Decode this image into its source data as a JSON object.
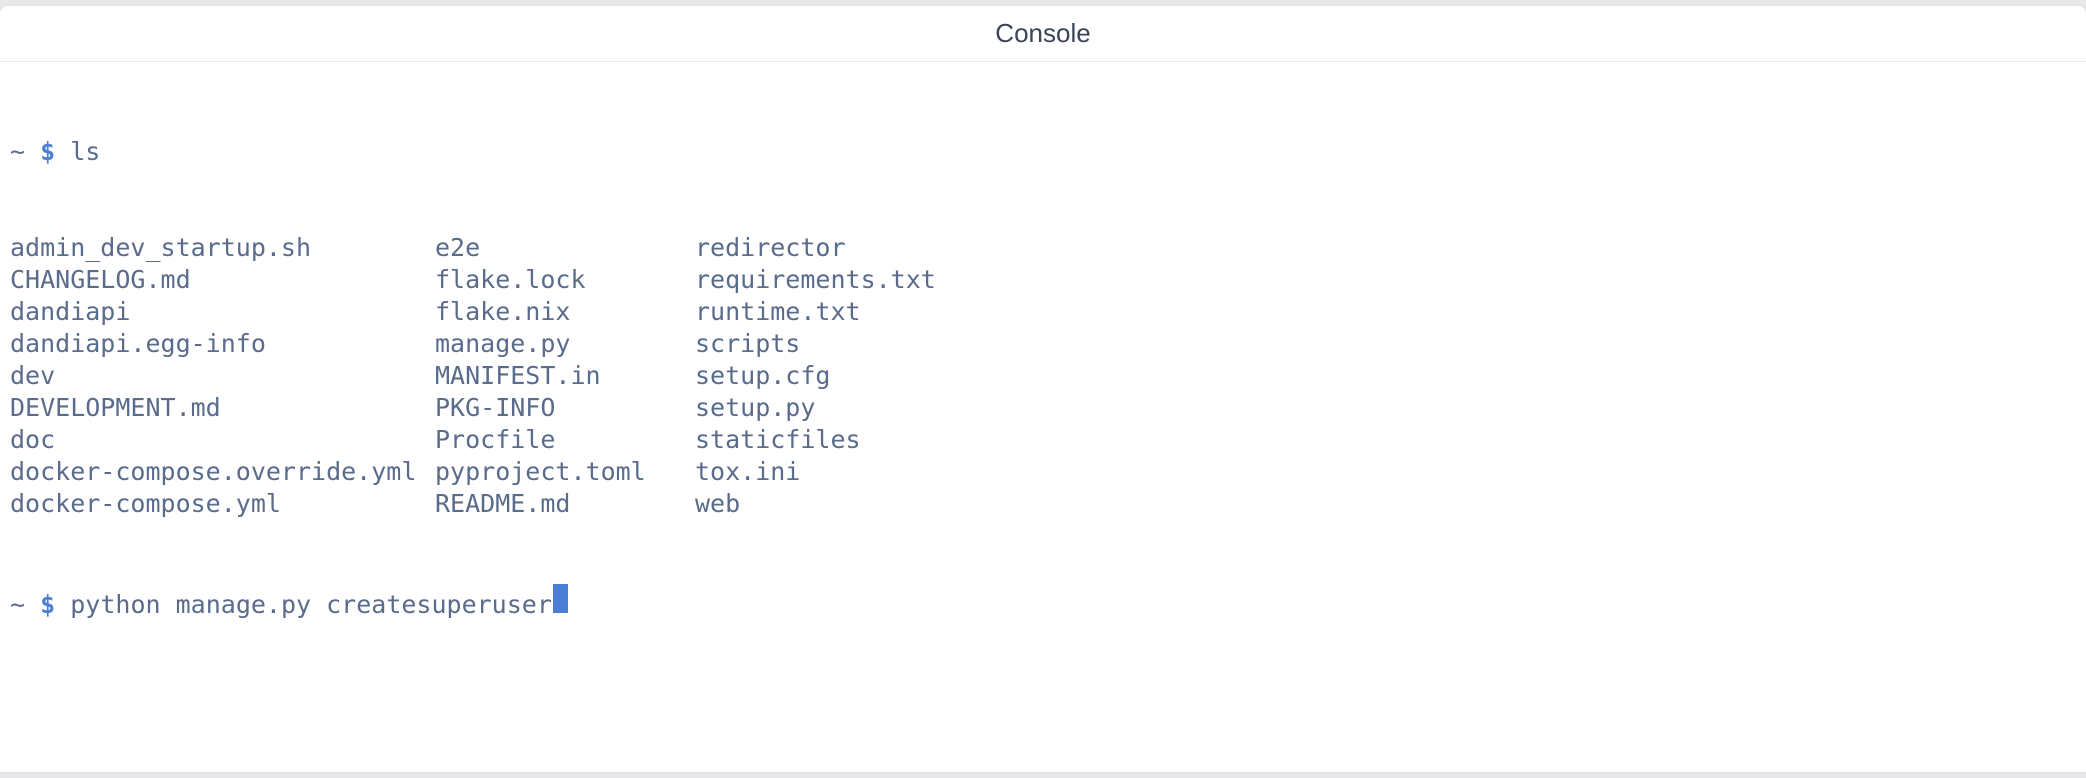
{
  "titlebar": {
    "title": "Console"
  },
  "terminal": {
    "prompt1": {
      "tilde": "~",
      "dollar": "$",
      "command": "ls"
    },
    "ls": {
      "col1": [
        "admin_dev_startup.sh",
        "CHANGELOG.md",
        "dandiapi",
        "dandiapi.egg-info",
        "dev",
        "DEVELOPMENT.md",
        "doc",
        "docker-compose.override.yml",
        "docker-compose.yml"
      ],
      "col2": [
        "e2e",
        "flake.lock",
        "flake.nix",
        "manage.py",
        "MANIFEST.in",
        "PKG-INFO",
        "Procfile",
        "pyproject.toml",
        "README.md"
      ],
      "col3": [
        "redirector",
        "requirements.txt",
        "runtime.txt",
        "scripts",
        "setup.cfg",
        "setup.py",
        "staticfiles",
        "tox.ini",
        "web"
      ]
    },
    "prompt2": {
      "tilde": "~",
      "dollar": "$",
      "command": "python manage.py createsuperuser"
    }
  }
}
